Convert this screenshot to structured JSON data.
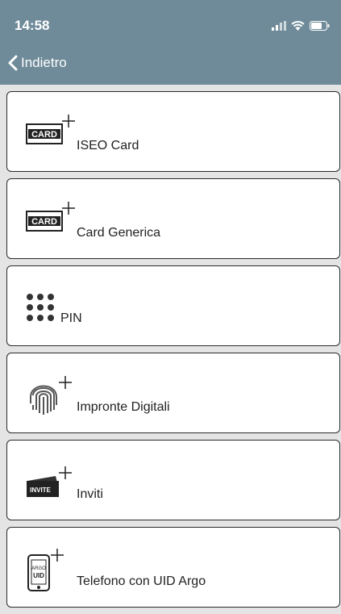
{
  "status_bar": {
    "time": "14:58"
  },
  "nav": {
    "back_label": "Indietro"
  },
  "items": [
    {
      "label": "ISEO Card",
      "icon": "card-plus-icon"
    },
    {
      "label": "Card Generica",
      "icon": "card-plus-icon"
    },
    {
      "label": "PIN",
      "icon": "keypad-dots-icon"
    },
    {
      "label": "Impronte Digitali",
      "icon": "fingerprint-plus-icon"
    },
    {
      "label": "Inviti",
      "icon": "invite-card-plus-icon"
    },
    {
      "label": "Telefono con UID Argo",
      "icon": "phone-uid-plus-icon"
    }
  ],
  "icon_text": {
    "card": "CARD",
    "invite": "INVITE",
    "argo": "ARGO",
    "uid": "UID"
  },
  "colors": {
    "header": "#6f8b99",
    "background": "#e4e4e4"
  }
}
